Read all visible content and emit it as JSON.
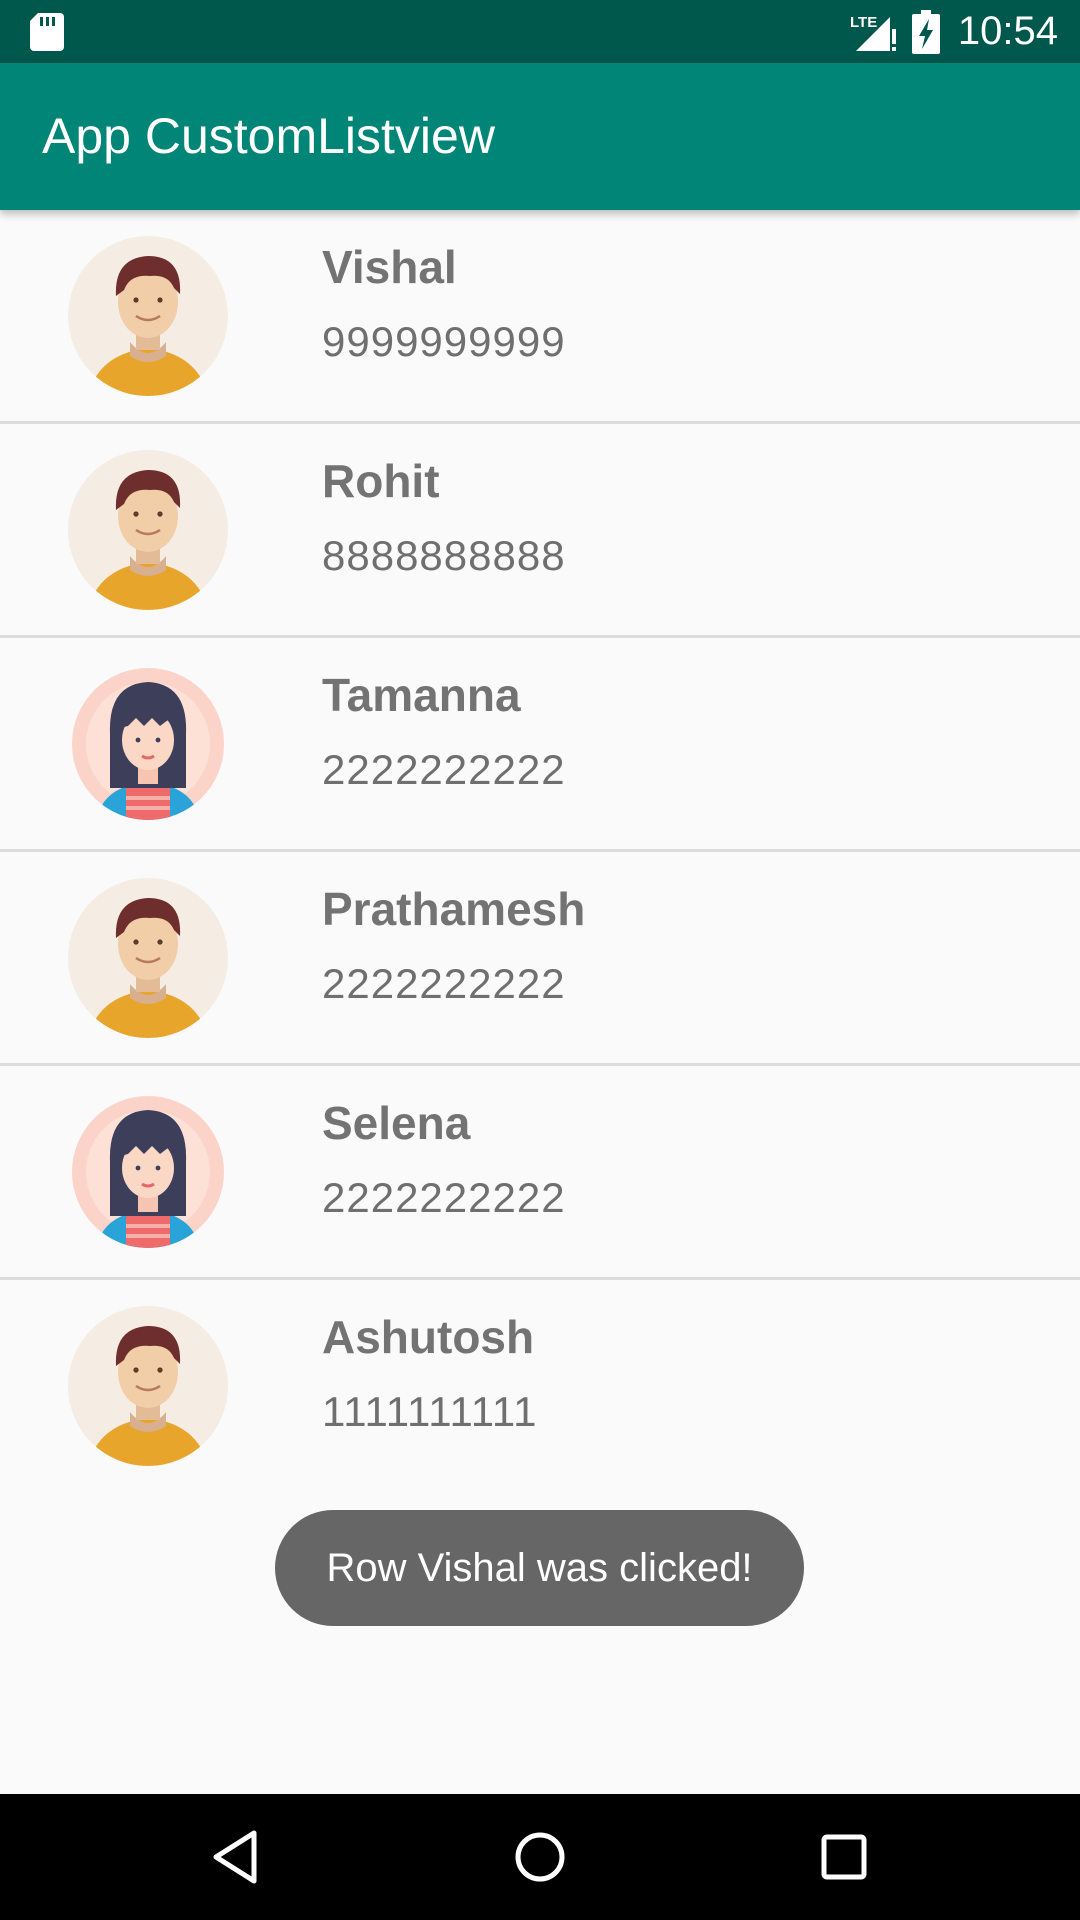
{
  "status_bar": {
    "time": "10:54",
    "network_label": "LTE",
    "icons": [
      "sd-card-icon",
      "lte-signal-icon",
      "battery-charging-icon"
    ]
  },
  "app_bar": {
    "title": "App CustomListview",
    "color": "#008577",
    "status_color": "#00574b"
  },
  "contacts": [
    {
      "name": "Vishal",
      "phone": "9999999999",
      "avatar": "male-avatar-icon"
    },
    {
      "name": "Rohit",
      "phone": "8888888888",
      "avatar": "male-avatar-icon"
    },
    {
      "name": "Tamanna",
      "phone": "2222222222",
      "avatar": "female-avatar-icon"
    },
    {
      "name": "Prathamesh",
      "phone": "2222222222",
      "avatar": "male-avatar-icon"
    },
    {
      "name": "Selena",
      "phone": "2222222222",
      "avatar": "female-avatar-icon"
    },
    {
      "name": "Ashutosh",
      "phone": "1111111111",
      "avatar": "male-avatar-icon"
    }
  ],
  "toast": {
    "message": "Row Vishal was clicked!"
  },
  "nav_bar": {
    "icons": [
      "back-icon",
      "home-icon",
      "recents-icon"
    ]
  }
}
